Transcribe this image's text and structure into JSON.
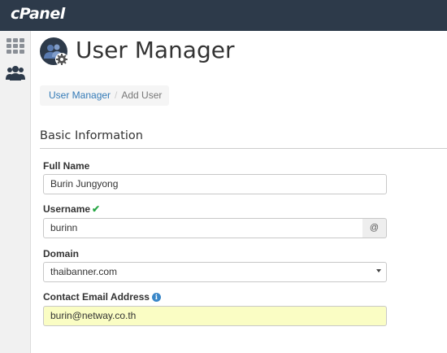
{
  "app": {
    "logo": "cPanel"
  },
  "sidebar": {
    "items": [
      {
        "icon": "grid-icon"
      },
      {
        "icon": "users-icon"
      }
    ]
  },
  "header": {
    "title": "User Manager",
    "icon": "user-manager-gear-icon"
  },
  "breadcrumb": {
    "link": "User Manager",
    "separator": "/",
    "current": "Add User"
  },
  "section": {
    "title": "Basic Information"
  },
  "form": {
    "full_name": {
      "label": "Full Name",
      "value": "Burin Jungyong"
    },
    "username": {
      "label": "Username",
      "valid_mark": "✔",
      "value": "burinn",
      "addon": "@"
    },
    "domain": {
      "label": "Domain",
      "value": "thaibanner.com"
    },
    "contact_email": {
      "label": "Contact Email Address",
      "info": "i",
      "value": "burin@netway.co.th"
    }
  },
  "colors": {
    "topbar": "#2d3a4a",
    "link": "#337ab7",
    "valid": "#28a745",
    "autofill": "#fafdc4"
  }
}
